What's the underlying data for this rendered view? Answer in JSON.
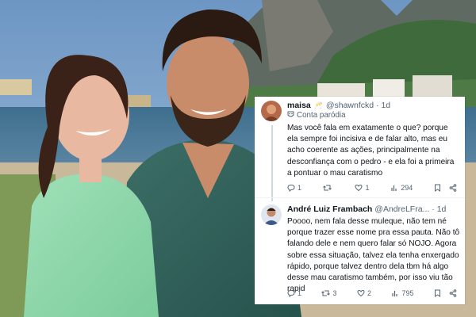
{
  "tweets": [
    {
      "name": "maisa",
      "badge": "🥂",
      "handle": "@shawnfckd · 1d",
      "label": "Conta paródia",
      "text": "Mas você fala em exatamente o que? porque ela sempre foi incisiva e de falar alto, mas eu acho coerente as ações, principalmente na desconfiança com o pedro - e ela foi a primeira a pontuar o mau caratismo",
      "replies": "1",
      "retweets": "",
      "likes": "1",
      "views": "294"
    },
    {
      "name": "André Luiz Frambach",
      "handle": "@AndreLFra... · 1d",
      "text": "Poooo, nem fala desse muleque, não tem né porque trazer esse nome pra essa pauta. Não tô falando dele e nem quero falar só NOJO. Agora sobre essa situação, talvez ela tenha enxergado rápido, porque talvez dentro dela tbm há algo desse mau caratismo também, por isso viu tão rapid",
      "replies": "1",
      "retweets": "3",
      "likes": "2",
      "views": "795"
    }
  ],
  "colors": {
    "text": "#0f1419",
    "muted": "#536471",
    "line": "#cfd9de"
  }
}
